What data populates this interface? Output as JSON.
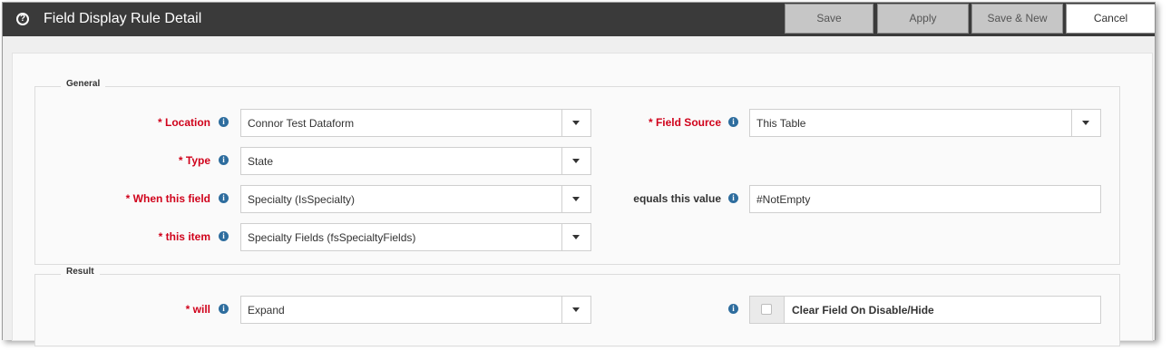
{
  "window": {
    "title": "Field Display Rule Detail",
    "icon": "question-circle-icon"
  },
  "toolbar": {
    "save_label": "Save",
    "apply_label": "Apply",
    "save_new_label": "Save & New",
    "cancel_label": "Cancel"
  },
  "general": {
    "legend": "General",
    "location": {
      "label": "* Location",
      "value": "Connor Test Dataform"
    },
    "type": {
      "label": "* Type",
      "value": "State"
    },
    "when_field": {
      "label": "* When this field",
      "value": "Specialty (IsSpecialty)"
    },
    "this_item": {
      "label": "* this item",
      "value": "Specialty Fields (fsSpecialtyFields)"
    },
    "field_source": {
      "label": "* Field Source",
      "value": "This Table"
    },
    "equals_value": {
      "label": "equals this value",
      "value": "#NotEmpty"
    }
  },
  "result": {
    "legend": "Result",
    "will": {
      "label": "* will",
      "value": "Expand"
    },
    "clear_field": {
      "label": "Clear Field On Disable/Hide",
      "checked": false
    }
  },
  "icons": {
    "info": "i"
  },
  "colors": {
    "titlebar": "#3a3a3a",
    "required_label": "#d0021b",
    "info_icon": "#2e6d9e"
  }
}
